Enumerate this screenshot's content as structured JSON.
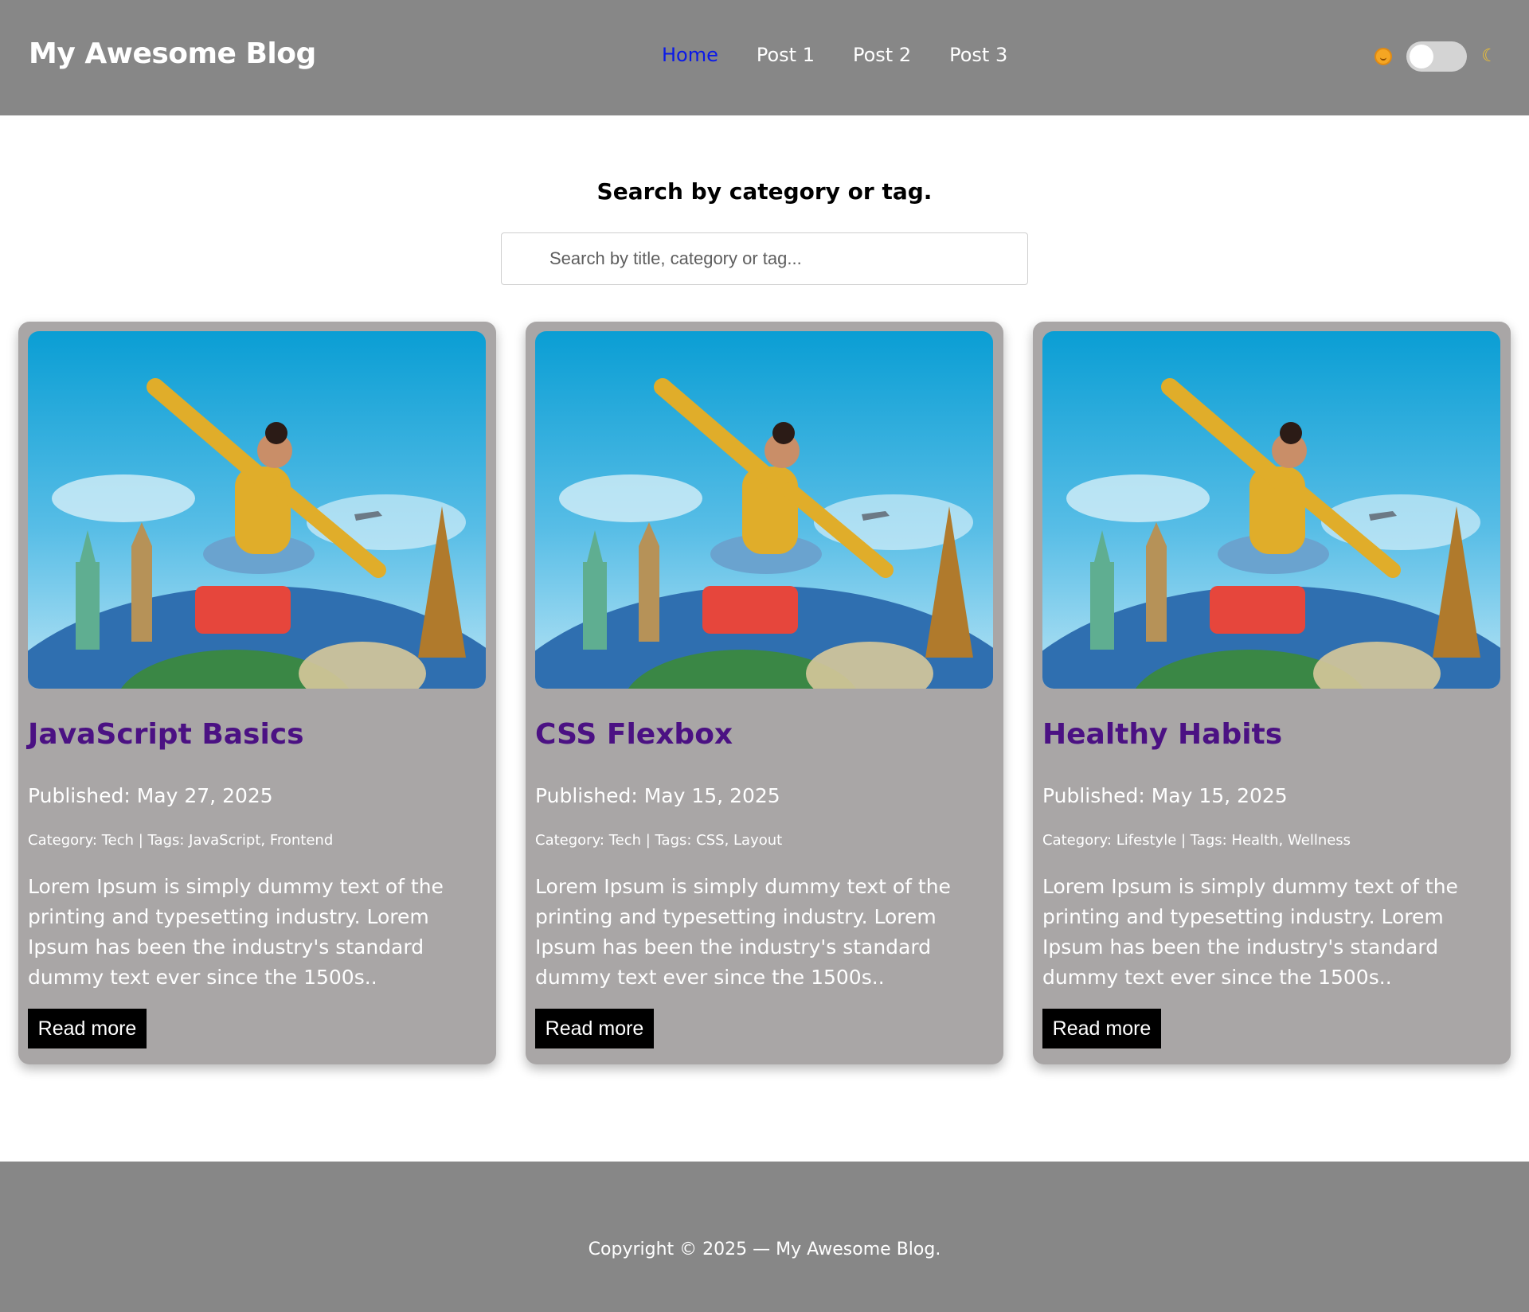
{
  "header": {
    "brand": "My Awesome Blog",
    "nav": [
      "Home",
      "Post 1",
      "Post 2",
      "Post 3"
    ],
    "active_nav": "Home",
    "theme_toggle": {
      "sun_icon": "sun-emoji-icon",
      "moon_icon": "moon-icon",
      "state": "off"
    }
  },
  "search": {
    "title": "Search by category or tag.",
    "placeholder": "Search by title, category or tag..."
  },
  "posts": [
    {
      "title": "JavaScript Basics",
      "published": "Published: May 27, 2025",
      "meta": "Category: Tech | Tags: JavaScript, Frontend",
      "excerpt": "Lorem Ipsum is simply dummy text of the printing and typesetting industry. Lorem Ipsum has been the industry's standard dummy text ever since the 1500s..",
      "button": "Read more"
    },
    {
      "title": "CSS Flexbox",
      "published": "Published: May 15, 2025",
      "meta": "Category: Tech | Tags: CSS, Layout",
      "excerpt": "Lorem Ipsum is simply dummy text of the printing and typesetting industry. Lorem Ipsum has been the industry's standard dummy text ever since the 1500s..",
      "button": "Read more"
    },
    {
      "title": "Healthy Habits",
      "published": "Published: May 15, 2025",
      "meta": "Category: Lifestyle | Tags: Health, Wellness",
      "excerpt": "Lorem Ipsum is simply dummy text of the printing and typesetting industry. Lorem Ipsum has been the industry's standard dummy text ever since the 1500s..",
      "button": "Read more"
    }
  ],
  "footer": {
    "copyright": "Copyright © 2025 — My Awesome Blog."
  },
  "colors": {
    "header_bg": "#878787",
    "card_bg": "#a9a6a6",
    "title_purple": "#4b1183",
    "active_link": "#0a19e8",
    "button_bg": "#000000"
  }
}
